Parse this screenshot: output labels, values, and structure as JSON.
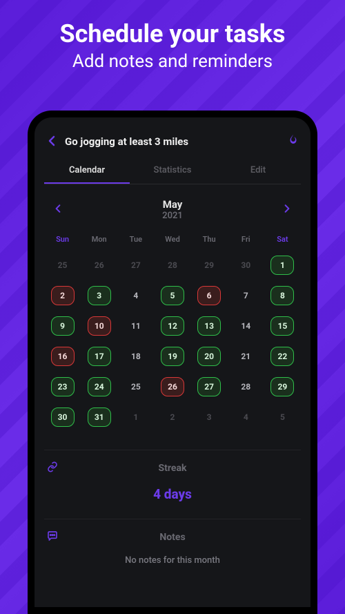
{
  "promo": {
    "title": "Schedule your tasks",
    "subtitle": "Add notes and reminders"
  },
  "header": {
    "task_title": "Go jogging at least 3 miles"
  },
  "tabs": {
    "calendar": "Calendar",
    "statistics": "Statistics",
    "edit": "Edit"
  },
  "month_nav": {
    "month": "May",
    "year": "2021"
  },
  "dow": [
    "Sun",
    "Mon",
    "Tue",
    "Wed",
    "Thu",
    "Fri",
    "Sat"
  ],
  "calendar_days": [
    {
      "n": "25",
      "state": "other"
    },
    {
      "n": "26",
      "state": "other"
    },
    {
      "n": "27",
      "state": "other"
    },
    {
      "n": "28",
      "state": "other"
    },
    {
      "n": "29",
      "state": "other"
    },
    {
      "n": "30",
      "state": "other"
    },
    {
      "n": "1",
      "state": "green"
    },
    {
      "n": "2",
      "state": "red"
    },
    {
      "n": "3",
      "state": "green"
    },
    {
      "n": "4",
      "state": "plain"
    },
    {
      "n": "5",
      "state": "green"
    },
    {
      "n": "6",
      "state": "red"
    },
    {
      "n": "7",
      "state": "plain"
    },
    {
      "n": "8",
      "state": "green"
    },
    {
      "n": "9",
      "state": "green"
    },
    {
      "n": "10",
      "state": "red"
    },
    {
      "n": "11",
      "state": "plain"
    },
    {
      "n": "12",
      "state": "green"
    },
    {
      "n": "13",
      "state": "green"
    },
    {
      "n": "14",
      "state": "plain"
    },
    {
      "n": "15",
      "state": "green"
    },
    {
      "n": "16",
      "state": "red"
    },
    {
      "n": "17",
      "state": "green"
    },
    {
      "n": "18",
      "state": "plain"
    },
    {
      "n": "19",
      "state": "green"
    },
    {
      "n": "20",
      "state": "green"
    },
    {
      "n": "21",
      "state": "plain"
    },
    {
      "n": "22",
      "state": "green"
    },
    {
      "n": "23",
      "state": "green"
    },
    {
      "n": "24",
      "state": "green"
    },
    {
      "n": "25",
      "state": "plain"
    },
    {
      "n": "26",
      "state": "red"
    },
    {
      "n": "27",
      "state": "green"
    },
    {
      "n": "28",
      "state": "plain"
    },
    {
      "n": "29",
      "state": "green"
    },
    {
      "n": "30",
      "state": "green"
    },
    {
      "n": "31",
      "state": "green"
    },
    {
      "n": "1",
      "state": "other"
    },
    {
      "n": "2",
      "state": "other"
    },
    {
      "n": "3",
      "state": "other"
    },
    {
      "n": "4",
      "state": "other"
    },
    {
      "n": "5",
      "state": "other"
    }
  ],
  "streak": {
    "label": "Streak",
    "value": "4 days"
  },
  "notes": {
    "label": "Notes",
    "empty": "No notes for this month"
  }
}
